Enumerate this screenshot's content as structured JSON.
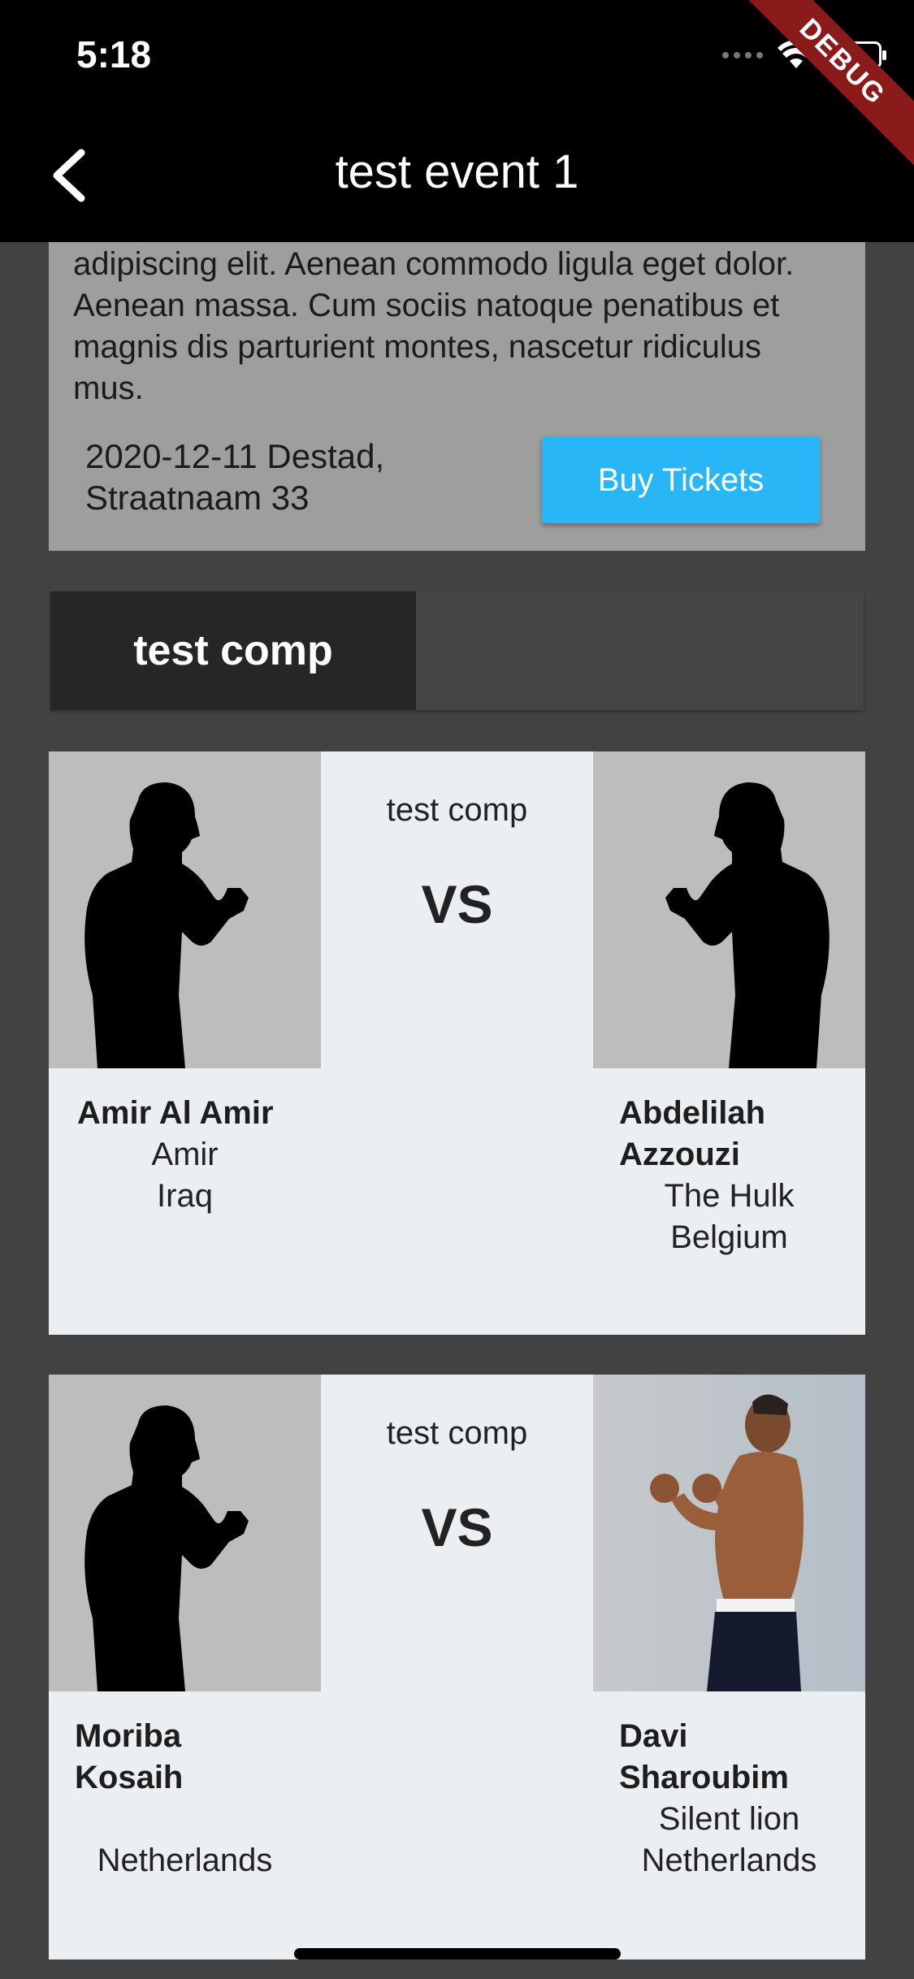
{
  "status_bar": {
    "time": "5:18",
    "debug_label": "DEBUG"
  },
  "app_bar": {
    "title": "test event 1",
    "back_icon": "chevron-left-icon"
  },
  "event": {
    "description": "adipiscing elit. Aenean commodo ligula eget dolor. Aenean massa. Cum sociis natoque penatibus et magnis dis parturient montes, nascetur ridiculus mus.",
    "date_location_line1": "2020-12-11 Destad,",
    "date_location_line2": "Straatnaam 33",
    "buy_label": "Buy Tickets"
  },
  "tabs": [
    {
      "label": "test comp",
      "active": true
    }
  ],
  "fights": [
    {
      "competition": "test comp",
      "vs": "VS",
      "left": {
        "name_line1": "Amir Al Amir",
        "name_line2": "",
        "nickname": "Amir",
        "country": "Iraq"
      },
      "right": {
        "name_line1": "Abdelilah",
        "name_line2": "Azzouzi",
        "nickname": "The Hulk",
        "country": "Belgium"
      }
    },
    {
      "competition": "test comp",
      "vs": "VS",
      "left": {
        "name_line1": "Moriba",
        "name_line2": "Kosaih",
        "nickname": "",
        "country": "Netherlands"
      },
      "right": {
        "name_line1": "Davi",
        "name_line2": "Sharoubim",
        "nickname": "Silent lion",
        "country": "Netherlands"
      }
    }
  ],
  "colors": {
    "accent": "#29b6f6",
    "card": "#eceff1",
    "background": "#424242"
  }
}
